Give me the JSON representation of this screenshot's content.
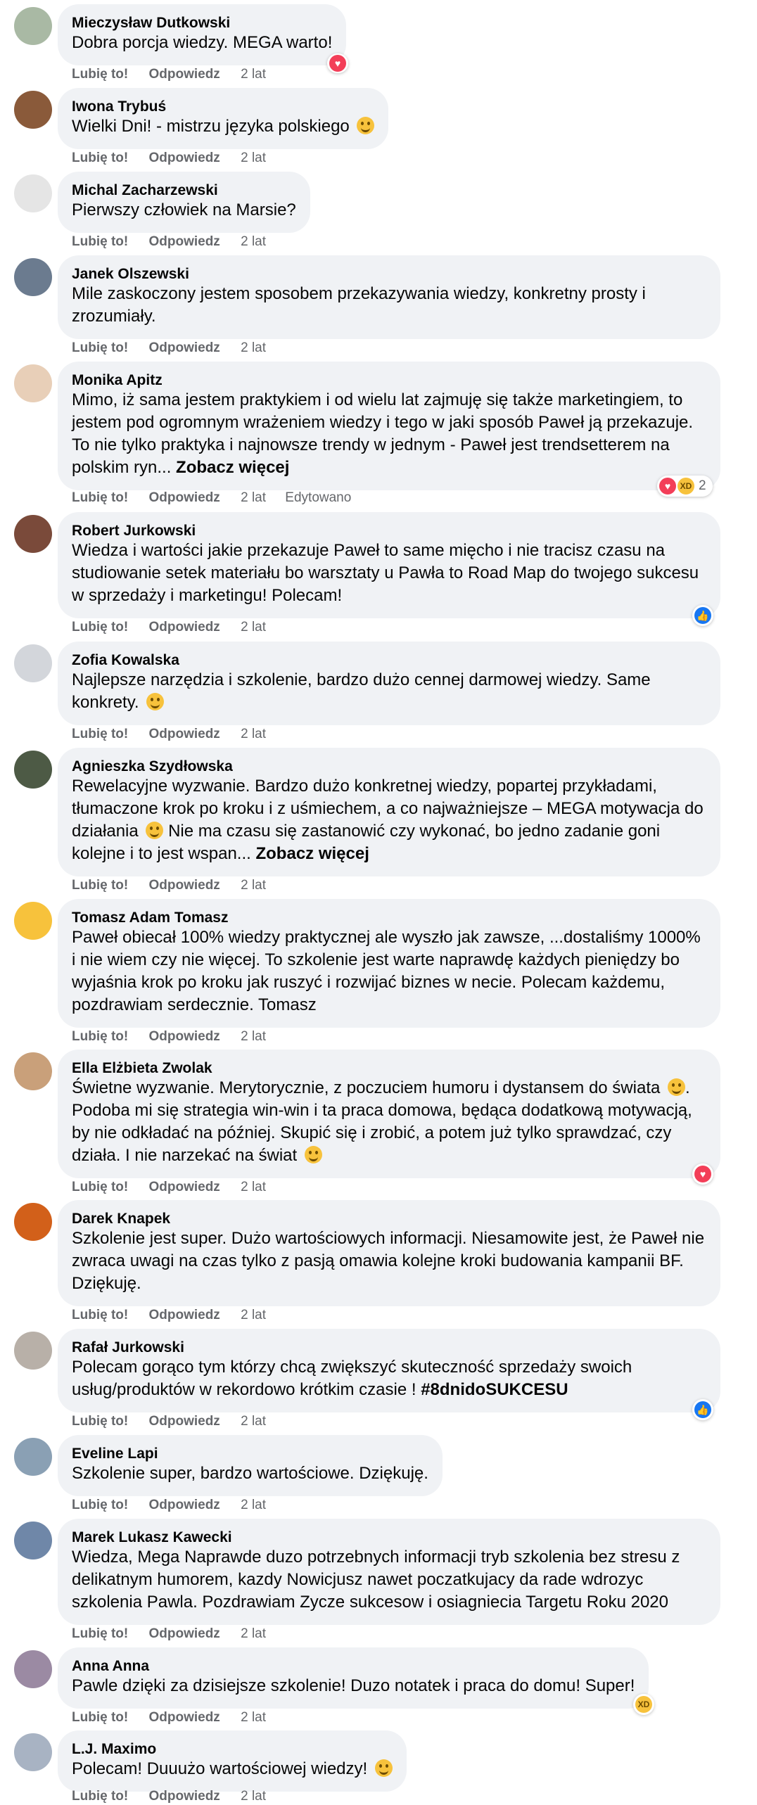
{
  "ui": {
    "like": "Lubię to!",
    "reply": "Odpowiedz",
    "see_more": "Zobacz więcej",
    "edited": "Edytowano"
  },
  "colors": {
    "bubble": "#f0f2f5",
    "meta": "#65676b",
    "love": "#f33e58",
    "like": "#1877f2"
  },
  "comments": [
    {
      "author": "Mieczysław Dutkowski",
      "text": "Dobra porcja wiedzy. MEGA warto!",
      "time": "2 lat",
      "reaction": "love-icon"
    },
    {
      "author": "Iwona Trybuś",
      "text": "Wielki Dni! - mistrzu języka polskiego",
      "time": "2 lat"
    },
    {
      "author": "Michal Zacharzewski",
      "text": "Pierwszy człowiek na Marsie?",
      "time": "2 lat"
    },
    {
      "author": "Janek Olszewski",
      "text": "Mile zaskoczony jestem sposobem przekazywania wiedzy, konkretny prosty i zrozumiały.",
      "time": "2 lat"
    },
    {
      "author": "Monika Apitz",
      "text": "Mimo, iż sama jestem praktykiem i od wielu lat zajmuję się także marketingiem, to jestem pod ogromnym wrażeniem wiedzy i tego w jaki sposób Paweł ją przekazuje. To nie tylko praktyka i najnowsze trendy w jednym - Paweł jest trendsetterem na polskim ryn...",
      "time": "2 lat",
      "edited": true,
      "reaction_count": "2"
    },
    {
      "author": "Robert Jurkowski",
      "text": "Wiedza i wartości jakie przekazuje Paweł to same mięcho i nie tracisz czasu na studiowanie setek materiału bo warsztaty u Pawła to Road Map do twojego sukcesu w sprzedaży i marketingu! Polecam!",
      "time": "2 lat"
    },
    {
      "author": "Zofia Kowalska",
      "text": "Najlepsze narzędzia i szkolenie, bardzo dużo cennej darmowej wiedzy. Same konkrety.",
      "time": "2 lat"
    },
    {
      "author": "Agnieszka Szydłowska",
      "text1": "Rewelacyjne wyzwanie. Bardzo dużo konkretnej wiedzy, popartej przykładami, tłumaczone krok po kroku i z uśmiechem, a co najważniejsze – MEGA motywacja do działania",
      "text2": "Nie ma czasu się zastanowić czy wykonać, bo jedno zadanie goni kolejne i to jest wspan...",
      "time": "2 lat"
    },
    {
      "author": "Tomasz Adam Tomasz",
      "text": "Paweł obiecał 100% wiedzy praktycznej ale wyszło jak zawsze, ...dostaliśmy 1000% i nie wiem czy nie więcej. To szkolenie jest warte naprawdę każdych pieniędzy bo wyjaśnia krok po kroku jak ruszyć i rozwijać biznes w necie. Polecam każdemu, pozdrawiam serdecznie. Tomasz",
      "time": "2 lat"
    },
    {
      "author": "Ella Elżbieta Zwolak",
      "text1": "Świetne wyzwanie. Merytorycznie, z poczuciem humoru i dystansem do świata",
      "text2": ". Podoba mi się strategia win-win i ta praca domowa, będąca dodatkową motywacją, by nie odkładać na później. Skupić się i zrobić, a potem już tylko sprawdzać, czy działa. I nie narzekać na świat",
      "time": "2 lat"
    },
    {
      "author": "Darek Knapek",
      "text": "Szkolenie jest super. Dużo wartościowych informacji. Niesamowite jest, że Paweł nie zwraca uwagi na czas tylko z pasją omawia kolejne kroki budowania kampanii BF. Dziękuję.",
      "time": "2 lat"
    },
    {
      "author": "Rafał Jurkowski",
      "text": "Polecam gorąco tym którzy chcą zwiększyć skuteczność sprzedaży swoich usług/produktów w rekordowo krótkim czasie !",
      "hashtag": "#8dnidoSUKCESU",
      "time": "2 lat"
    },
    {
      "author": "Eveline Lapi",
      "text": "Szkolenie super, bardzo wartościowe. Dziękuję.",
      "time": "2 lat"
    },
    {
      "author": "Marek Lukasz Kawecki",
      "text": "Wiedza, Mega Naprawde duzo potrzebnych informacji tryb szkolenia bez stresu z delikatnym humorem, kazdy Nowicjusz nawet poczatkujacy da rade wdrozyc szkolenia Pawla. Pozdrawiam Zycze sukcesow i osiagniecia Targetu Roku 2020",
      "time": "2 lat"
    },
    {
      "author": "Anna Anna",
      "text": "Pawle dzięki za dzisiejsze szkolenie! Duzo notatek i praca do domu! Super!",
      "time": "2 lat"
    },
    {
      "author": "L.J. Maximo",
      "text": "Polecam! Duuużo wartościowej wiedzy!",
      "time": "2 lat"
    }
  ]
}
